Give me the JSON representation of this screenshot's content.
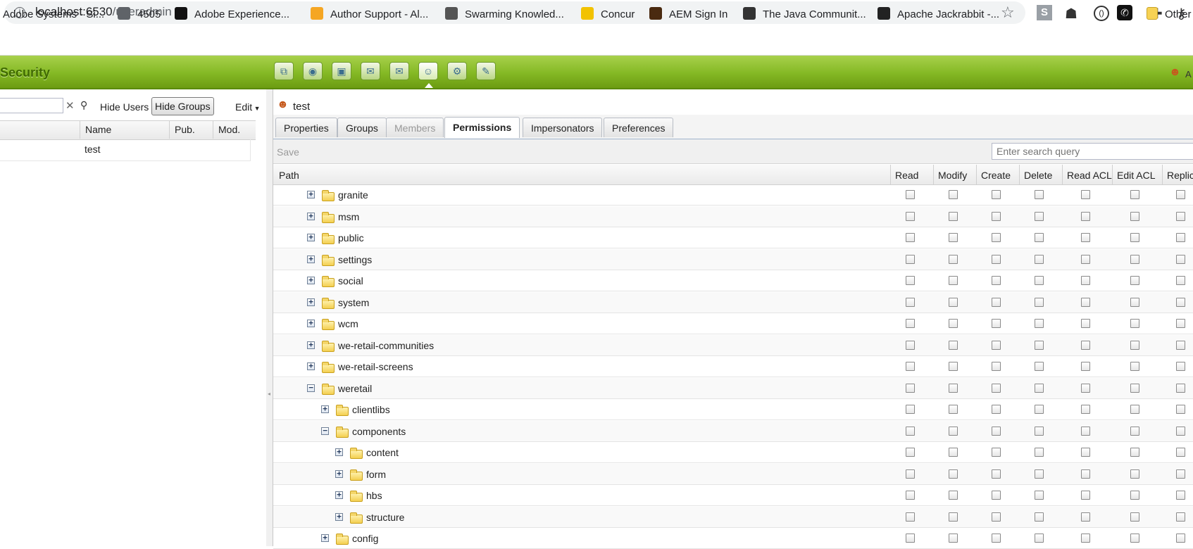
{
  "browser": {
    "url_host": "localhost:6530",
    "url_path": "/useradmin",
    "extensions": {
      "s_label": "S",
      "circle_label": "()"
    },
    "bookmarks": [
      {
        "label": "Adobe Systems - Si...",
        "icon": "blank-icon",
        "color": ""
      },
      {
        "label": "4505",
        "icon": "globe-icon",
        "color": "#5f6368"
      },
      {
        "label": "Adobe Experience...",
        "icon": "graduation-cap-icon",
        "color": "#111111"
      },
      {
        "label": "Author Support - Al...",
        "icon": "grid-icon",
        "color": "#f5a623"
      },
      {
        "label": "Swarming Knowled...",
        "icon": "document-icon",
        "color": "#555555"
      },
      {
        "label": "Concur",
        "icon": "concur-icon",
        "color": "#f2c200"
      },
      {
        "label": "AEM Sign In",
        "icon": "aem-icon",
        "color": "#4a2a10"
      },
      {
        "label": "The Java Communit...",
        "icon": "java-icon",
        "color": "#333333"
      },
      {
        "label": "Apache Jackrabbit -...",
        "icon": "feather-icon",
        "color": "#222222"
      }
    ],
    "more_label": "»",
    "other_label": "Other"
  },
  "app": {
    "title": "Security",
    "user_initial": "A",
    "accent": "#84b824"
  },
  "left": {
    "hide_users": "Hide Users",
    "hide_groups": "Hide Groups",
    "edit": "Edit",
    "columns": [
      "Name",
      "Pub.",
      "Mod."
    ],
    "rows": [
      {
        "name": "test"
      }
    ]
  },
  "right": {
    "user_name": "test",
    "tabs": [
      "Properties",
      "Groups",
      "Members",
      "Permissions",
      "Impersonators",
      "Preferences"
    ],
    "active_tab": "Permissions",
    "save": "Save",
    "search_placeholder": "Enter search query",
    "columns": [
      "Path",
      "Read",
      "Modify",
      "Create",
      "Delete",
      "Read ACL",
      "Edit ACL",
      "Replic"
    ],
    "tree": [
      {
        "label": "granite",
        "level": 0,
        "expanded": false
      },
      {
        "label": "msm",
        "level": 0,
        "expanded": false
      },
      {
        "label": "public",
        "level": 0,
        "expanded": false
      },
      {
        "label": "settings",
        "level": 0,
        "expanded": false
      },
      {
        "label": "social",
        "level": 0,
        "expanded": false
      },
      {
        "label": "system",
        "level": 0,
        "expanded": false
      },
      {
        "label": "wcm",
        "level": 0,
        "expanded": false
      },
      {
        "label": "we-retail-communities",
        "level": 0,
        "expanded": false
      },
      {
        "label": "we-retail-screens",
        "level": 0,
        "expanded": false
      },
      {
        "label": "weretail",
        "level": 0,
        "expanded": true
      },
      {
        "label": "clientlibs",
        "level": 1,
        "expanded": false
      },
      {
        "label": "components",
        "level": 1,
        "expanded": true
      },
      {
        "label": "content",
        "level": 2,
        "expanded": false
      },
      {
        "label": "form",
        "level": 2,
        "expanded": false
      },
      {
        "label": "hbs",
        "level": 2,
        "expanded": false
      },
      {
        "label": "structure",
        "level": 2,
        "expanded": false
      },
      {
        "label": "config",
        "level": 1,
        "expanded": false
      }
    ]
  }
}
